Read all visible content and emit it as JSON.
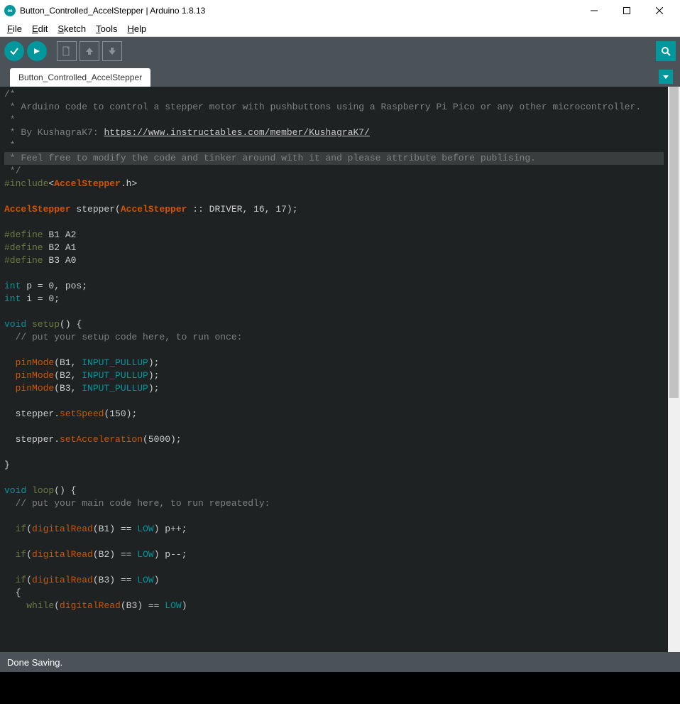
{
  "window": {
    "title": "Button_Controlled_AccelStepper | Arduino 1.8.13"
  },
  "menu": {
    "file": "File",
    "edit": "Edit",
    "sketch": "Sketch",
    "tools": "Tools",
    "help": "Help"
  },
  "tabs": {
    "active": "Button_Controlled_AccelStepper"
  },
  "status": {
    "message": "Done Saving."
  },
  "code": {
    "comment_open": "/*",
    "comment_l1": " * Arduino code to control a stepper motor with pushbuttons using a Raspberry Pi Pico or any other microcontroller.",
    "comment_l2": " * ",
    "comment_l3a": " * By KushagraK7: ",
    "comment_l3b_url": "https://www.instructables.com/member/KushagraK7/",
    "comment_l4": " * ",
    "comment_l5": " * Feel free to modify the code and tinker around with it and please attribute before publising.",
    "comment_close": " */",
    "include_a": "#include",
    "include_b": "<",
    "include_c": "AccelStepper",
    "include_d": ".h>",
    "decl_a": "AccelStepper",
    "decl_b": " stepper(",
    "decl_c": "AccelStepper",
    "decl_d": " :: DRIVER, 16, 17);",
    "def1a": "#define",
    "def1b": " B1 A2",
    "def2a": "#define",
    "def2b": " B2 A1",
    "def3a": "#define",
    "def3b": " B3 A0",
    "int1a": "int",
    "int1b": " p = 0, pos;",
    "int2a": "int",
    "int2b": " i = 0;",
    "void1a": "void",
    "void1b": " ",
    "void1c": "setup",
    "void1d": "() {",
    "setup_comment": "  // put your setup code here, to run once:",
    "pm1a": "  ",
    "pm1b": "pinMode",
    "pm1c": "(B1, ",
    "pm1d": "INPUT_PULLUP",
    "pm1e": ");",
    "pm2a": "  ",
    "pm2b": "pinMode",
    "pm2c": "(B2, ",
    "pm2d": "INPUT_PULLUP",
    "pm2e": ");",
    "pm3a": "  ",
    "pm3b": "pinMode",
    "pm3c": "(B3, ",
    "pm3d": "INPUT_PULLUP",
    "pm3e": ");",
    "ss1a": "  stepper.",
    "ss1b": "setSpeed",
    "ss1c": "(150);",
    "sa1a": "  stepper.",
    "sa1b": "setAcceleration",
    "sa1c": "(5000);",
    "brace_close": "}",
    "void2a": "void",
    "void2b": " ",
    "void2c": "loop",
    "void2d": "() {",
    "loop_comment": "  // put your main code here, to run repeatedly:",
    "if1a": "  ",
    "if1b": "if",
    "if1c": "(",
    "if1d": "digitalRead",
    "if1e": "(B1) == ",
    "if1f": "LOW",
    "if1g": ") p++;",
    "if2a": "  ",
    "if2b": "if",
    "if2c": "(",
    "if2d": "digitalRead",
    "if2e": "(B2) == ",
    "if2f": "LOW",
    "if2g": ") p--;",
    "if3a": "  ",
    "if3b": "if",
    "if3c": "(",
    "if3d": "digitalRead",
    "if3e": "(B3) == ",
    "if3f": "LOW",
    "if3g": ")",
    "brace_open2": "  {",
    "wh1a": "    ",
    "wh1b": "while",
    "wh1c": "(",
    "wh1d": "digitalRead",
    "wh1e": "(B3) == ",
    "wh1f": "LOW",
    "wh1g": ")"
  }
}
